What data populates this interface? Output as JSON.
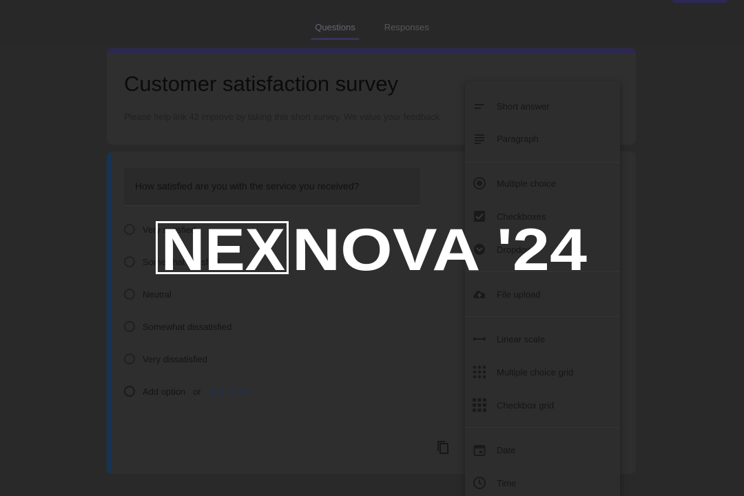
{
  "tabs": [
    {
      "label": "Questions"
    },
    {
      "label": "Responses"
    }
  ],
  "form": {
    "title": "Customer satisfaction survey",
    "description": "Please help link 42 improve by taking this short survey. We value your feedback"
  },
  "question": {
    "text": "How satisfied are you with the service you received?",
    "options": [
      {
        "label": "Very satisfied"
      },
      {
        "label": "Somewhat satisfied"
      },
      {
        "label": "Neutral"
      },
      {
        "label": "Somewhat dissatisfied"
      },
      {
        "label": "Very dissatisfied"
      }
    ],
    "add_option": "Add option",
    "or": "or",
    "add_other": "add \"Other\""
  },
  "menu": {
    "items": [
      {
        "label": "Short answer",
        "icon": "short-answer-icon"
      },
      {
        "label": "Paragraph",
        "icon": "paragraph-icon"
      },
      {
        "label": "Multiple choice",
        "icon": "radio-icon"
      },
      {
        "label": "Checkboxes",
        "icon": "checkbox-icon"
      },
      {
        "label": "Dropdown",
        "icon": "dropdown-icon"
      },
      {
        "label": "File upload",
        "icon": "cloud-upload-icon"
      },
      {
        "label": "Linear scale",
        "icon": "linear-scale-icon"
      },
      {
        "label": "Multiple choice grid",
        "icon": "grid-icon"
      },
      {
        "label": "Checkbox grid",
        "icon": "checkbox-grid-icon"
      },
      {
        "label": "Date",
        "icon": "calendar-icon"
      },
      {
        "label": "Time",
        "icon": "clock-icon"
      }
    ]
  },
  "logo": {
    "brand": "NEXNOVA '24"
  },
  "colors": {
    "accent": "#2f2a55",
    "logo": "#ffffff"
  }
}
